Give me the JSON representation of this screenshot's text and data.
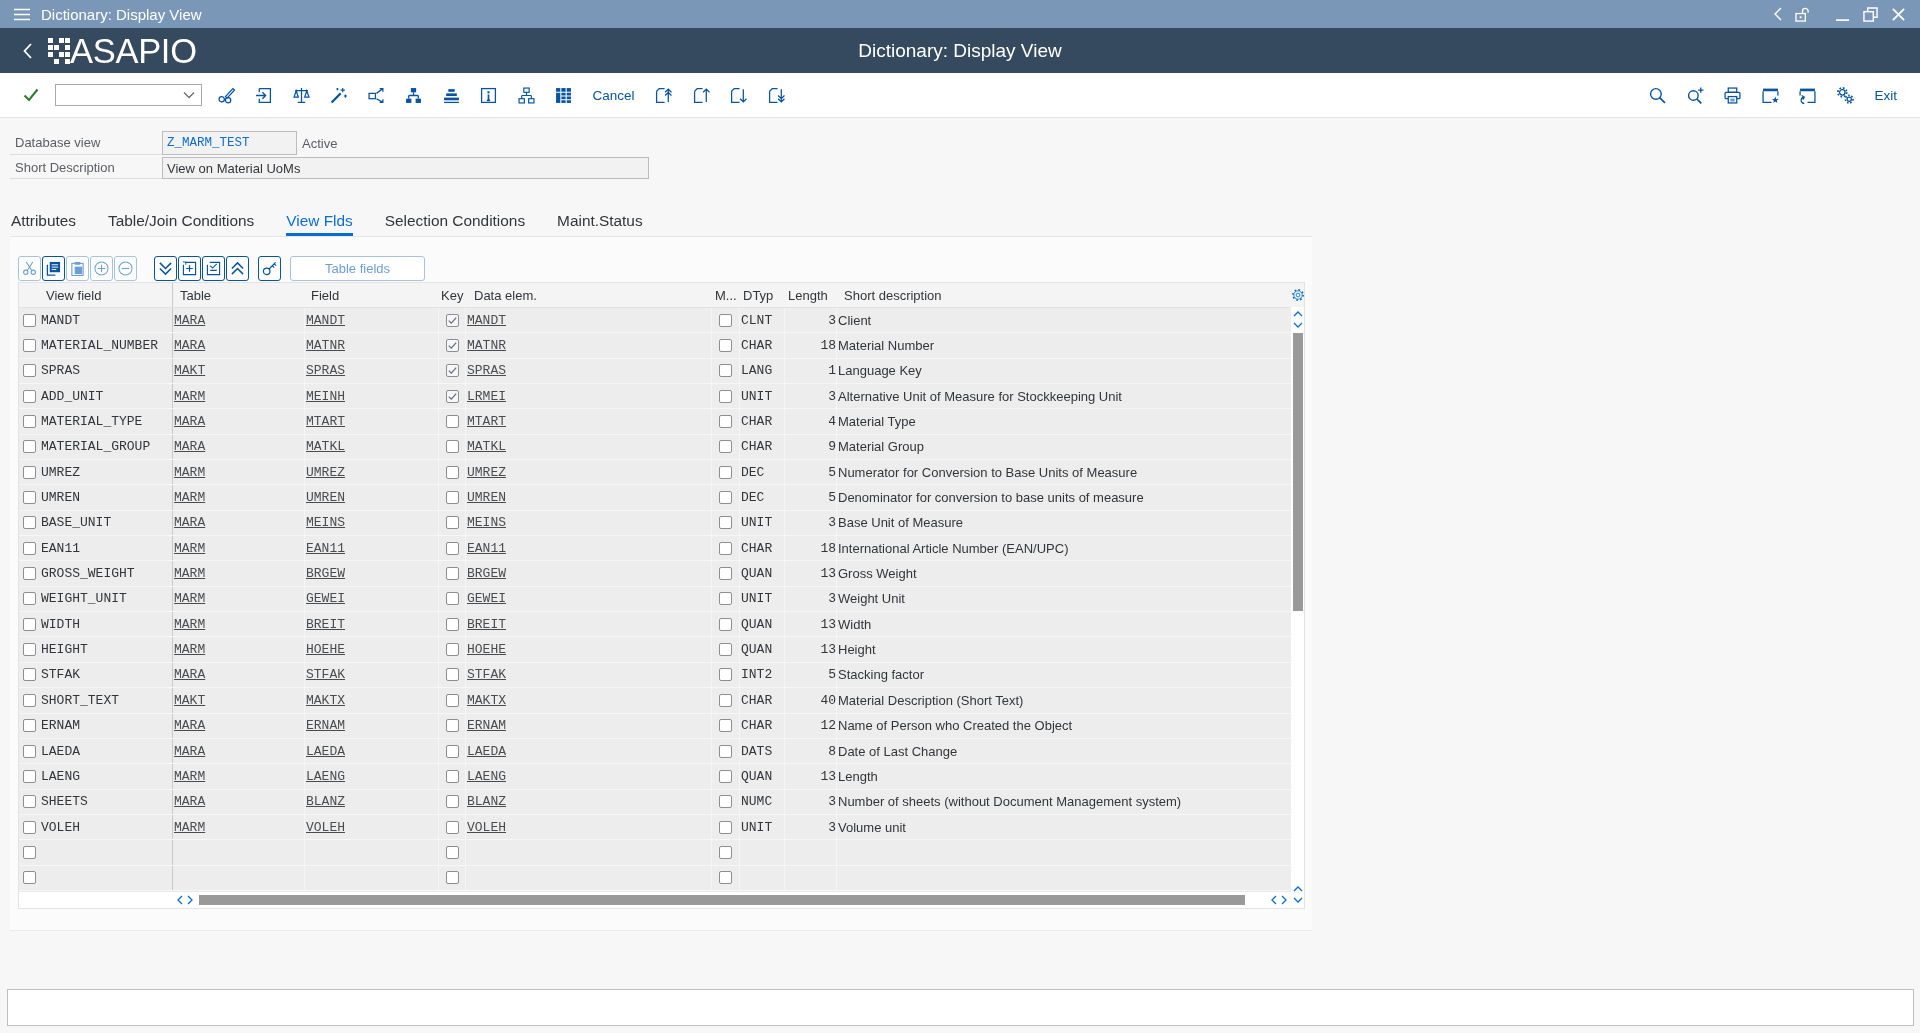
{
  "window": {
    "title": "Dictionary: Display View"
  },
  "shell": {
    "logo": "ASAPIO",
    "title": "Dictionary: Display View"
  },
  "toolbar": {
    "cancel_label": "Cancel",
    "exit_label": "Exit"
  },
  "header_fields": [
    {
      "label": "Database view",
      "value": "Z_MARM_TEST",
      "status": "Active"
    },
    {
      "label": "Short Description",
      "value": "View on Material UoMs"
    }
  ],
  "tabs": [
    {
      "label": "Attributes",
      "selected": false
    },
    {
      "label": "Table/Join Conditions",
      "selected": false
    },
    {
      "label": "View Flds",
      "selected": true
    },
    {
      "label": "Selection Conditions",
      "selected": false
    },
    {
      "label": "Maint.Status",
      "selected": false
    }
  ],
  "table_toolbar": {
    "buttons": [
      {
        "disabled": true
      },
      {
        "disabled": false
      },
      {
        "disabled": true
      },
      {
        "disabled": true
      },
      {
        "disabled": true
      },
      {
        "disabled": false
      },
      {
        "disabled": false
      },
      {
        "disabled": false
      },
      {
        "disabled": false
      },
      {
        "disabled": false
      }
    ],
    "table_fields": {
      "label": "Table fields",
      "disabled": true
    }
  },
  "table": {
    "columns": [
      "View field",
      "Table",
      "Field",
      "Key",
      "Data elem.",
      "M...",
      "DTyp",
      "Length",
      "Short description"
    ],
    "rows": [
      {
        "kind": "entry",
        "selected": false,
        "view_field": "MANDT",
        "table": "MARA",
        "field": "MANDT",
        "key": true,
        "data_element": "MANDT",
        "m": false,
        "dtyp": "CLNT",
        "length": "3",
        "short_description": "Client"
      },
      {
        "kind": "entry",
        "selected": false,
        "view_field": "MATERIAL_NUMBER",
        "table": "MARA",
        "field": "MATNR",
        "key": true,
        "data_element": "MATNR",
        "m": false,
        "dtyp": "CHAR",
        "length": "18",
        "short_description": "Material Number"
      },
      {
        "kind": "entry",
        "selected": false,
        "view_field": "SPRAS",
        "table": "MAKT",
        "field": "SPRAS",
        "key": true,
        "data_element": "SPRAS",
        "m": false,
        "dtyp": "LANG",
        "length": "1",
        "short_description": "Language Key"
      },
      {
        "kind": "entry",
        "selected": false,
        "view_field": "ADD_UNIT",
        "table": "MARM",
        "field": "MEINH",
        "key": true,
        "data_element": "LRMEI",
        "m": false,
        "dtyp": "UNIT",
        "length": "3",
        "short_description": "Alternative Unit of Measure for Stockkeeping Unit"
      },
      {
        "kind": "entry",
        "selected": false,
        "view_field": "MATERIAL_TYPE",
        "table": "MARA",
        "field": "MTART",
        "key": false,
        "data_element": "MTART",
        "m": false,
        "dtyp": "CHAR",
        "length": "4",
        "short_description": "Material Type"
      },
      {
        "kind": "entry",
        "selected": false,
        "view_field": "MATERIAL_GROUP",
        "table": "MARA",
        "field": "MATKL",
        "key": false,
        "data_element": "MATKL",
        "m": false,
        "dtyp": "CHAR",
        "length": "9",
        "short_description": "Material Group"
      },
      {
        "kind": "entry",
        "selected": false,
        "view_field": "UMREZ",
        "table": "MARM",
        "field": "UMREZ",
        "key": false,
        "data_element": "UMREZ",
        "m": false,
        "dtyp": "DEC",
        "length": "5",
        "short_description": "Numerator for Conversion to Base Units of Measure"
      },
      {
        "kind": "entry",
        "selected": false,
        "view_field": "UMREN",
        "table": "MARM",
        "field": "UMREN",
        "key": false,
        "data_element": "UMREN",
        "m": false,
        "dtyp": "DEC",
        "length": "5",
        "short_description": "Denominator for conversion to base units of measure"
      },
      {
        "kind": "entry",
        "selected": false,
        "view_field": "BASE_UNIT",
        "table": "MARA",
        "field": "MEINS",
        "key": false,
        "data_element": "MEINS",
        "m": false,
        "dtyp": "UNIT",
        "length": "3",
        "short_description": "Base Unit of Measure"
      },
      {
        "kind": "entry",
        "selected": false,
        "view_field": "EAN11",
        "table": "MARM",
        "field": "EAN11",
        "key": false,
        "data_element": "EAN11",
        "m": false,
        "dtyp": "CHAR",
        "length": "18",
        "short_description": "International Article Number (EAN/UPC)"
      },
      {
        "kind": "entry",
        "selected": false,
        "view_field": "GROSS_WEIGHT",
        "table": "MARM",
        "field": "BRGEW",
        "key": false,
        "data_element": "BRGEW",
        "m": false,
        "dtyp": "QUAN",
        "length": "13",
        "short_description": "Gross Weight"
      },
      {
        "kind": "entry",
        "selected": false,
        "view_field": "WEIGHT_UNIT",
        "table": "MARM",
        "field": "GEWEI",
        "key": false,
        "data_element": "GEWEI",
        "m": false,
        "dtyp": "UNIT",
        "length": "3",
        "short_description": "Weight Unit"
      },
      {
        "kind": "entry",
        "selected": false,
        "view_field": "WIDTH",
        "table": "MARM",
        "field": "BREIT",
        "key": false,
        "data_element": "BREIT",
        "m": false,
        "dtyp": "QUAN",
        "length": "13",
        "short_description": "Width"
      },
      {
        "kind": "entry",
        "selected": false,
        "view_field": "HEIGHT",
        "table": "MARM",
        "field": "HOEHE",
        "key": false,
        "data_element": "HOEHE",
        "m": false,
        "dtyp": "QUAN",
        "length": "13",
        "short_description": "Height"
      },
      {
        "kind": "entry",
        "selected": false,
        "view_field": "STFAK",
        "table": "MARA",
        "field": "STFAK",
        "key": false,
        "data_element": "STFAK",
        "m": false,
        "dtyp": "INT2",
        "length": "5",
        "short_description": "Stacking factor"
      },
      {
        "kind": "entry",
        "selected": false,
        "view_field": "SHORT_TEXT",
        "table": "MAKT",
        "field": "MAKTX",
        "key": false,
        "data_element": "MAKTX",
        "m": false,
        "dtyp": "CHAR",
        "length": "40",
        "short_description": "Material Description (Short Text)"
      },
      {
        "kind": "entry",
        "selected": false,
        "view_field": "ERNAM",
        "table": "MARA",
        "field": "ERNAM",
        "key": false,
        "data_element": "ERNAM",
        "m": false,
        "dtyp": "CHAR",
        "length": "12",
        "short_description": "Name of Person who Created the Object"
      },
      {
        "kind": "entry",
        "selected": false,
        "view_field": "LAEDA",
        "table": "MARA",
        "field": "LAEDA",
        "key": false,
        "data_element": "LAEDA",
        "m": false,
        "dtyp": "DATS",
        "length": "8",
        "short_description": "Date of Last Change"
      },
      {
        "kind": "entry",
        "selected": false,
        "view_field": "LAENG",
        "table": "MARM",
        "field": "LAENG",
        "key": false,
        "data_element": "LAENG",
        "m": false,
        "dtyp": "QUAN",
        "length": "13",
        "short_description": "Length"
      },
      {
        "kind": "entry",
        "selected": false,
        "view_field": "SHEETS",
        "table": "MARA",
        "field": "BLANZ",
        "key": false,
        "data_element": "BLANZ",
        "m": false,
        "dtyp": "NUMC",
        "length": "3",
        "short_description": "Number of sheets (without Document Management system)"
      },
      {
        "kind": "entry",
        "selected": false,
        "view_field": "VOLEH",
        "table": "MARM",
        "field": "VOLEH",
        "key": false,
        "data_element": "VOLEH",
        "m": false,
        "dtyp": "UNIT",
        "length": "3",
        "short_description": "Volume unit"
      },
      {
        "kind": "empty",
        "selected": false,
        "key": false,
        "m": false
      },
      {
        "kind": "empty",
        "selected": false,
        "key": false,
        "m": false
      }
    ]
  }
}
